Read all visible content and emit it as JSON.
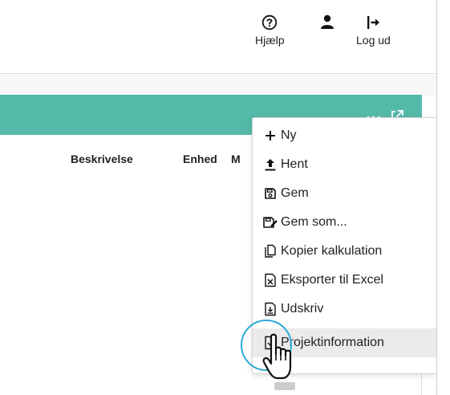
{
  "header": {
    "help_label": "Hjælp",
    "logout_label": "Log ud"
  },
  "table": {
    "columns": [
      "Beskrivelse",
      "Enhed",
      "M"
    ]
  },
  "menu": {
    "items": [
      {
        "label": "Ny",
        "icon": "plus-icon"
      },
      {
        "label": "Hent",
        "icon": "upload-icon"
      },
      {
        "label": "Gem",
        "icon": "save-icon"
      },
      {
        "label": "Gem som...",
        "icon": "save-as-icon"
      },
      {
        "label": "Kopier kalkulation",
        "icon": "copy-icon"
      },
      {
        "label": "Eksporter til Excel",
        "icon": "excel-file-icon"
      },
      {
        "label": "Udskriv",
        "icon": "print-file-icon"
      },
      {
        "label": "Projektinformation",
        "icon": "info-file-icon"
      }
    ],
    "hovered_item": "Projektinformation"
  },
  "colors": {
    "panel_header": "#55b9a9",
    "menu_hover": "#ebebeb",
    "cursor_ring": "#2aa9d8"
  }
}
